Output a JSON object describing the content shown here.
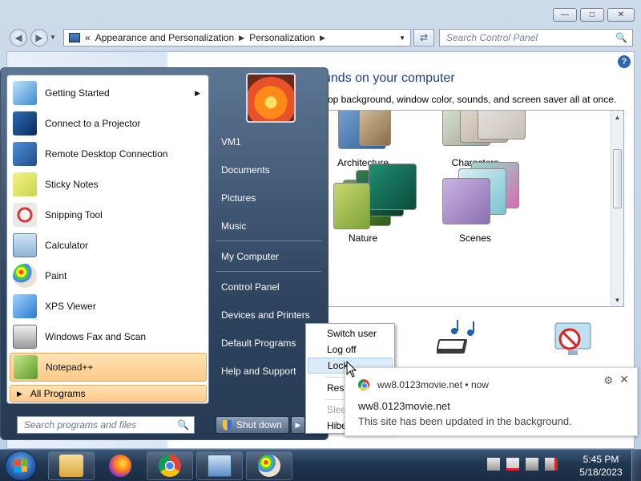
{
  "window": {
    "controls": {
      "minimize": "—",
      "maximize": "□",
      "close": "✕"
    }
  },
  "nav": {
    "back_icon": "back-arrow-icon",
    "forward_icon": "forward-arrow-icon"
  },
  "address": {
    "overflow": "«",
    "crumbs": [
      "Appearance and Personalization",
      "Personalization"
    ]
  },
  "search_cp": {
    "placeholder": "Search Control Panel"
  },
  "content": {
    "heading": "unds on your computer",
    "subheading": "op background, window color, sounds, and screen saver all at once.",
    "themes": [
      {
        "label": "Architecture"
      },
      {
        "label": "Characters"
      },
      {
        "label": "Nature"
      },
      {
        "label": "Scenes"
      }
    ]
  },
  "start_menu": {
    "programs": [
      {
        "label": "Getting Started",
        "icon": "getting-started-icon",
        "has_submenu": true
      },
      {
        "label": "Connect to a Projector",
        "icon": "projector-icon"
      },
      {
        "label": "Remote Desktop Connection",
        "icon": "remote-desktop-icon"
      },
      {
        "label": "Sticky Notes",
        "icon": "sticky-notes-icon"
      },
      {
        "label": "Snipping Tool",
        "icon": "snipping-tool-icon"
      },
      {
        "label": "Calculator",
        "icon": "calculator-icon"
      },
      {
        "label": "Paint",
        "icon": "paint-icon"
      },
      {
        "label": "XPS Viewer",
        "icon": "xps-viewer-icon"
      },
      {
        "label": "Windows Fax and Scan",
        "icon": "fax-scan-icon"
      },
      {
        "label": "Notepad++",
        "icon": "notepad-plus-plus-icon",
        "highlighted": true
      }
    ],
    "all_programs": "All Programs",
    "search_placeholder": "Search programs and files",
    "right_items": [
      "VM1",
      "Documents",
      "Pictures",
      "Music",
      "My Computer",
      "Control Panel",
      "Devices and Printers",
      "Default Programs",
      "Help and Support"
    ],
    "shutdown_label": "Shut down"
  },
  "shutdown_menu": {
    "items": [
      {
        "label": "Switch user"
      },
      {
        "label": "Log off"
      },
      {
        "label": "Lock",
        "hovered": true
      },
      {
        "label": "Rest"
      },
      {
        "label": "Slee",
        "disabled": true
      },
      {
        "label": "Hibe"
      }
    ]
  },
  "notification": {
    "source": "ww8.0123movie.net",
    "time": "now",
    "title": "ww8.0123movie.net",
    "body": "This site has been updated in the background."
  },
  "taskbar": {
    "apps": [
      "explorer-icon",
      "firefox-icon",
      "chrome-icon",
      "control-panel-icon",
      "paint-icon"
    ],
    "clock_time": "5:45 PM",
    "clock_date": "5/18/2023"
  },
  "colors": {
    "accent_orange": "#fdc98a",
    "heading_blue": "#1e3f91",
    "hover_blue": "#dcebfc"
  }
}
